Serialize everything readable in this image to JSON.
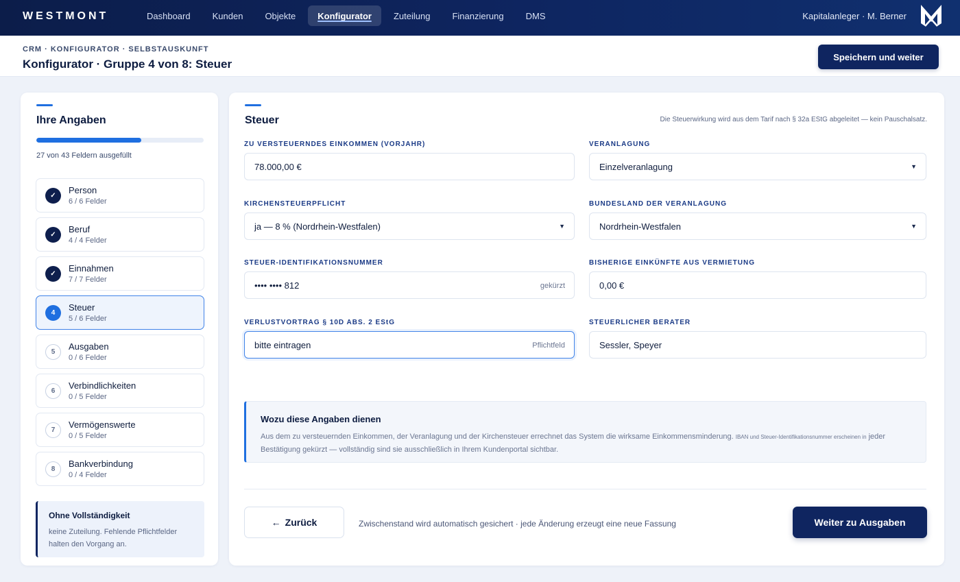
{
  "nav": {
    "brand": "WESTMONT",
    "items": [
      "Dashboard",
      "Kunden",
      "Objekte",
      "Konfigurator",
      "Zuteilung",
      "Finanzierung",
      "DMS"
    ],
    "active_index": 3,
    "user": "Kapitalanleger · M. Berner"
  },
  "header": {
    "breadcrumb": "CRM · KONFIGURATOR · SELBSTAUSKUNFT",
    "title": "Konfigurator · Gruppe 4 von 8: Steuer",
    "save_label": "Speichern und weiter"
  },
  "sidebar": {
    "title": "Ihre Angaben",
    "progress_fraction": 0.6279,
    "progress_text": "27 von 43 Feldern ausgefüllt",
    "steps": [
      {
        "badge": "✓",
        "state": "done",
        "name": "Person",
        "count": "6 / 6 Felder"
      },
      {
        "badge": "✓",
        "state": "done",
        "name": "Beruf",
        "count": "4 / 4 Felder"
      },
      {
        "badge": "✓",
        "state": "done",
        "name": "Einnahmen",
        "count": "7 / 7 Felder"
      },
      {
        "badge": "4",
        "state": "current",
        "name": "Steuer",
        "count": "5 / 6 Felder"
      },
      {
        "badge": "5",
        "state": "todo",
        "name": "Ausgaben",
        "count": "0 / 6 Felder"
      },
      {
        "badge": "6",
        "state": "todo",
        "name": "Verbindlichkeiten",
        "count": "0 / 5 Felder"
      },
      {
        "badge": "7",
        "state": "todo",
        "name": "Vermögenswerte",
        "count": "0 / 5 Felder"
      },
      {
        "badge": "8",
        "state": "todo",
        "name": "Bankverbindung",
        "count": "0 / 4 Felder"
      }
    ],
    "notice": {
      "title": "Ohne Vollständigkeit",
      "text": "keine Zuteilung. Fehlende Pflichtfelder halten den Vorgang an."
    }
  },
  "main": {
    "title": "Steuer",
    "hint": "Die Steuerwirkung wird aus dem Tarif nach § 32a EStG abgeleitet — kein Pauschalsatz.",
    "fields": {
      "income": {
        "label": "ZU VERSTEUERNDES EINKOMMEN (VORJAHR)",
        "value": "78.000,00 €"
      },
      "assessment": {
        "label": "VERANLAGUNG",
        "value": "Einzelveranlagung"
      },
      "church_tax": {
        "label": "KIRCHENSTEUERPFLICHT",
        "value": "ja — 8 % (Nordrhein-Westfalen)"
      },
      "state": {
        "label": "BUNDESLAND DER VERANLAGUNG",
        "value": "Nordrhein-Westfalen"
      },
      "tax_id": {
        "label": "STEUER-IDENTIFIKATIONSNUMMER",
        "value": "•••• •••• 812",
        "suffix": "gekürzt"
      },
      "rental_income": {
        "label": "BISHERIGE EINKÜNFTE AUS VERMIETUNG",
        "value": "0,00 €"
      },
      "loss_carry": {
        "label": "VERLUSTVORTRAG § 10D ABS. 2 EStG",
        "value": "bitte eintragen",
        "suffix": "Pflichtfeld"
      },
      "advisor": {
        "label": "STEUERLICHER BERATER",
        "value": "Sessler, Speyer"
      }
    },
    "info": {
      "title": "Wozu diese Angaben dienen",
      "text_main": "Aus dem zu versteuernden Einkommen, der Veranlagung und der Kirchensteuer errechnet das System die wirksame Einkommensminderung.",
      "text_small": "IBAN und Steuer-Identifikationsnummer erscheinen in",
      "text_end": "jeder Bestätigung gekürzt — vollständig sind sie ausschließlich in Ihrem Kundenportal sichtbar."
    },
    "back_label": "Zurück",
    "back_arrow": "←",
    "autosave": "Zwischenstand wird automatisch gesichert · jede Änderung erzeugt eine neue Fassung",
    "next_label": "Weiter zu Ausgaben"
  },
  "colors": {
    "nav_bg": "#0e2560",
    "primary": "#0f2560",
    "accent": "#1f6fe0"
  }
}
